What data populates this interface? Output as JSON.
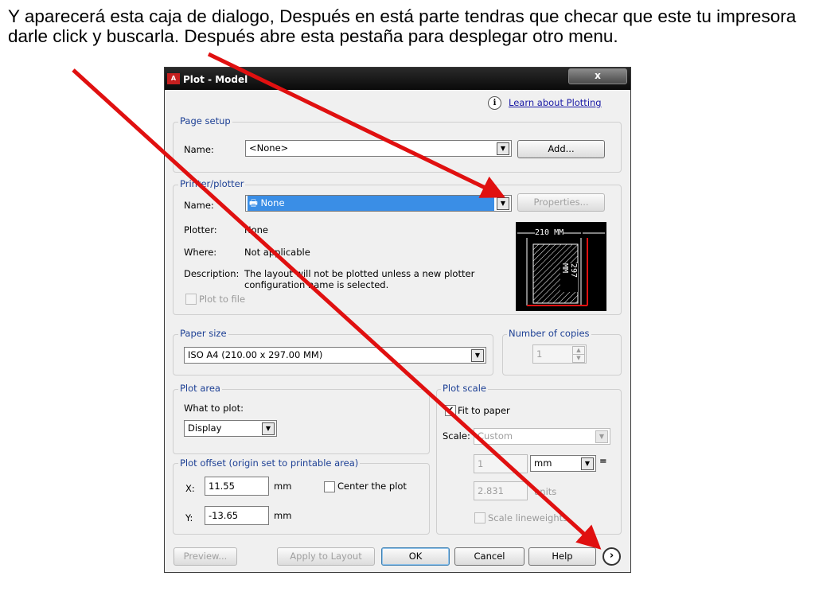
{
  "caption": "Y aparecerá esta caja de dialogo, Después en está parte tendras que checar que este tu impresora darle click y buscarla. Después abre esta pestaña para desplegar otro menu.",
  "dialog": {
    "app_icon_text": "A",
    "title": "Plot - Model",
    "close_glyph": "x",
    "learn_link": "Learn about Plotting",
    "page_setup": {
      "title": "Page setup",
      "name_label": "Name:",
      "name_value": "<None>",
      "add_button": "Add..."
    },
    "printer": {
      "title": "Printer/plotter",
      "name_label": "Name:",
      "name_value": "None",
      "properties_button": "Properties...",
      "plotter_label": "Plotter:",
      "plotter_value": "None",
      "where_label": "Where:",
      "where_value": "Not applicable",
      "description_label": "Description:",
      "description_line1": "The layout will not be plotted unless a new plotter",
      "description_line2": "configuration name is selected.",
      "plot_to_file": "Plot to file",
      "preview_width_label": "210 MM",
      "preview_height_label": "297 MM"
    },
    "paper_size": {
      "title": "Paper size",
      "value": "ISO A4 (210.00 x 297.00 MM)"
    },
    "copies": {
      "title": "Number of copies",
      "value": "1"
    },
    "plot_area": {
      "title": "Plot area",
      "what_label": "What to plot:",
      "what_value": "Display"
    },
    "plot_offset": {
      "title": "Plot offset (origin set to printable area)",
      "x_label": "X:",
      "x_value": "11.55",
      "x_unit": "mm",
      "y_label": "Y:",
      "y_value": "-13.65",
      "y_unit": "mm",
      "center_label": "Center the plot"
    },
    "plot_scale": {
      "title": "Plot scale",
      "fit_label": "Fit to paper",
      "fit_checked": true,
      "scale_label": "Scale:",
      "scale_value": "Custom",
      "top_value": "1",
      "unit_value": "mm",
      "equals": "=",
      "bottom_value": "2.831",
      "units_label": "units",
      "lineweights_label": "Scale lineweights"
    },
    "buttons": {
      "preview": "Preview...",
      "apply": "Apply to Layout",
      "ok": "OK",
      "cancel": "Cancel",
      "help": "Help",
      "expand_glyph": "›"
    }
  },
  "colors": {
    "annotation_arrow": "#e01010",
    "selection": "#3a8ee6",
    "title_bar": "#111111"
  }
}
